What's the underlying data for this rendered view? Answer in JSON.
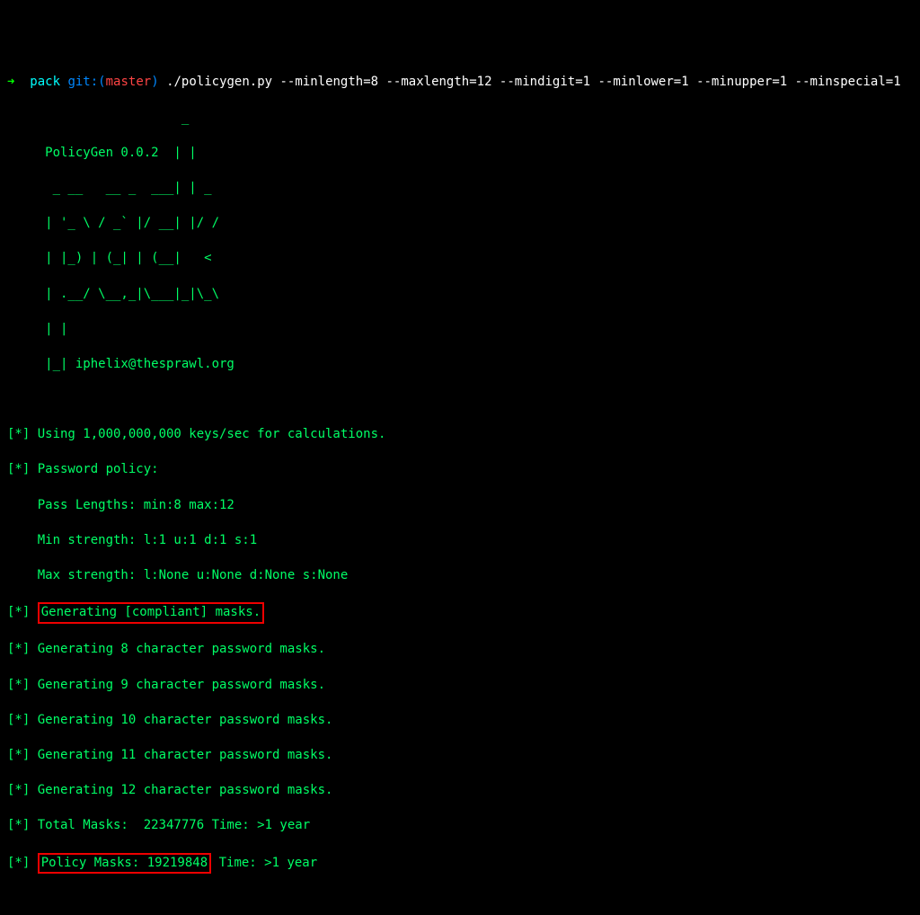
{
  "prompt": {
    "arrow": "➜",
    "dir": "pack",
    "git_label": "git:(",
    "branch": "master",
    "paren_close": ")",
    "command": "./policygen.py --minlength=8 --maxlength=12 --mindigit=1 --minlower=1 --minupper=1 --minspecial=1"
  },
  "banner": {
    "l1": "                       _",
    "l2": "     PolicyGen 0.0.2  | |",
    "l3": "      _ __   __ _  ___| | _",
    "l4": "     | '_ \\ / _` |/ __| |/ /",
    "l5": "     | |_) | (_| | (__|   <",
    "l6": "     | .__/ \\__,_|\\___|_|\\_\\",
    "l7": "     | |",
    "l8": "     |_| iphelix@thesprawl.org"
  },
  "output": {
    "blank": "",
    "calc": "[*] Using 1,000,000,000 keys/sec for calculations.",
    "policy_header": "[*] Password policy:",
    "pass_lengths": "    Pass Lengths: min:8 max:12",
    "min_strength": "    Min strength: l:1 u:1 d:1 s:1",
    "max_strength": "    Max strength: l:None u:None d:None s:None",
    "gen_compliant_prefix": "[*] ",
    "gen_compliant_box": "Generating [compliant] masks.",
    "gen8": "[*] Generating 8 character password masks.",
    "gen9": "[*] Generating 9 character password masks.",
    "gen10": "[*] Generating 10 character password masks.",
    "gen11": "[*] Generating 11 character password masks.",
    "gen12": "[*] Generating 12 character password masks.",
    "total_masks": "[*] Total Masks:  22347776 Time: >1 year",
    "policy_masks_prefix": "[*] ",
    "policy_masks_box": "Policy Masks: 19219848",
    "policy_masks_suffix": " Time: >1 year"
  }
}
